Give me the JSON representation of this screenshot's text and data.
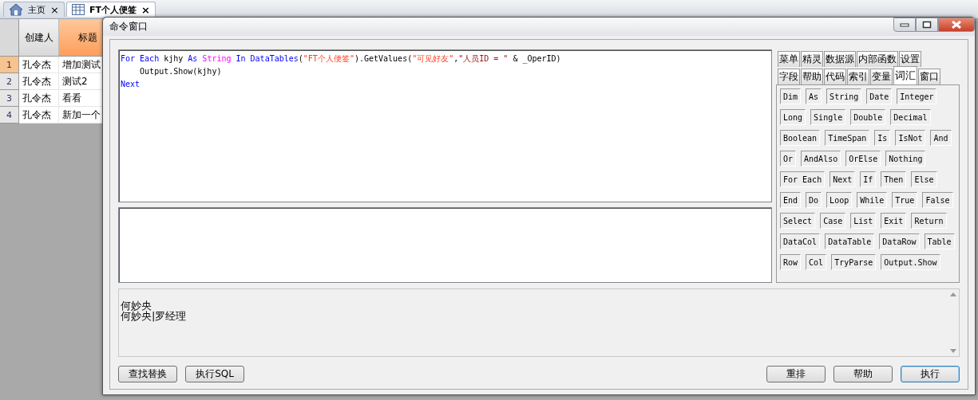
{
  "app_tabs": [
    {
      "label": "主页",
      "close": "×",
      "selected": false
    },
    {
      "label": "FT个人便签",
      "close": "×",
      "selected": true
    }
  ],
  "grid": {
    "columns": [
      {
        "label": "创建人",
        "selected": false
      },
      {
        "label": "标题",
        "selected": true
      }
    ],
    "rows": [
      {
        "number": "1",
        "selected": true,
        "cells": [
          "孔令杰",
          "增加测试"
        ]
      },
      {
        "number": "2",
        "selected": false,
        "cells": [
          "孔令杰",
          "测试2"
        ]
      },
      {
        "number": "3",
        "selected": false,
        "cells": [
          "孔令杰",
          "看看"
        ]
      },
      {
        "number": "4",
        "selected": false,
        "cells": [
          "孔令杰",
          "新加一个"
        ]
      }
    ]
  },
  "dialog": {
    "title": "命令窗口",
    "code_lines": [
      [
        {
          "kind": "keyword",
          "text": "For Each"
        },
        {
          "kind": "plain",
          "text": " kjhy "
        },
        {
          "kind": "keyword",
          "text": "As"
        },
        {
          "kind": "type",
          "text": " String"
        },
        {
          "kind": "keyword",
          "text": " In"
        },
        {
          "kind": "keyword",
          "text": " DataTables"
        },
        {
          "kind": "plain",
          "text": "("
        },
        {
          "kind": "string",
          "text": "\"FT个人便签\""
        },
        {
          "kind": "plain",
          "text": ").GetValues("
        },
        {
          "kind": "string",
          "text": "\"可见好友\""
        },
        {
          "kind": "plain",
          "text": ","
        },
        {
          "kind": "string2",
          "text": "\"人员ID = \""
        },
        {
          "kind": "plain",
          "text": " & _OperID)"
        }
      ],
      [
        {
          "kind": "plain",
          "text": "    Output.Show(kjhy)"
        }
      ],
      [
        {
          "kind": "keyword",
          "text": "Next"
        }
      ]
    ],
    "panel_tabs": [
      [
        {
          "label": "菜单",
          "selected": false
        },
        {
          "label": "精灵",
          "selected": false
        },
        {
          "label": "数据源",
          "selected": false
        },
        {
          "label": "内部函数",
          "selected": false
        },
        {
          "label": "设置",
          "selected": false
        }
      ],
      [
        {
          "label": "字段",
          "selected": false
        },
        {
          "label": "帮助",
          "selected": false
        },
        {
          "label": "代码",
          "selected": false
        },
        {
          "label": "索引",
          "selected": false
        },
        {
          "label": "变量",
          "selected": false
        },
        {
          "label": "词汇",
          "selected": true
        },
        {
          "label": "窗口",
          "selected": false
        }
      ]
    ],
    "keywords": [
      [
        "Dim",
        "As",
        "String",
        "Date",
        "Integer"
      ],
      [
        "Long",
        "Single",
        "Double",
        "Decimal"
      ],
      [
        "Boolean",
        "TimeSpan",
        "Is",
        "IsNot",
        "And"
      ],
      [
        "Or",
        "AndAlso",
        "OrElse",
        "Nothing"
      ],
      [
        "For Each",
        "Next",
        "If",
        "Then",
        "Else"
      ],
      [
        "End",
        "Do",
        "Loop",
        "While",
        "True",
        "False"
      ],
      [
        "Select",
        "Case",
        "List",
        "Exit",
        "Return"
      ],
      [
        "DataCol",
        "DataTable",
        "DataRow",
        "Table"
      ],
      [
        "Row",
        "Col",
        "TryParse",
        "Output.Show"
      ]
    ],
    "output_lines": [
      "何妙央",
      "何妙央|罗经理"
    ],
    "left_buttons": [
      {
        "label": "查找替换",
        "default": false
      },
      {
        "label": "执行SQL",
        "default": false
      }
    ],
    "right_buttons": [
      {
        "label": "重排",
        "default": false
      },
      {
        "label": "帮助",
        "default": false
      },
      {
        "label": "执行",
        "default": true
      }
    ]
  }
}
